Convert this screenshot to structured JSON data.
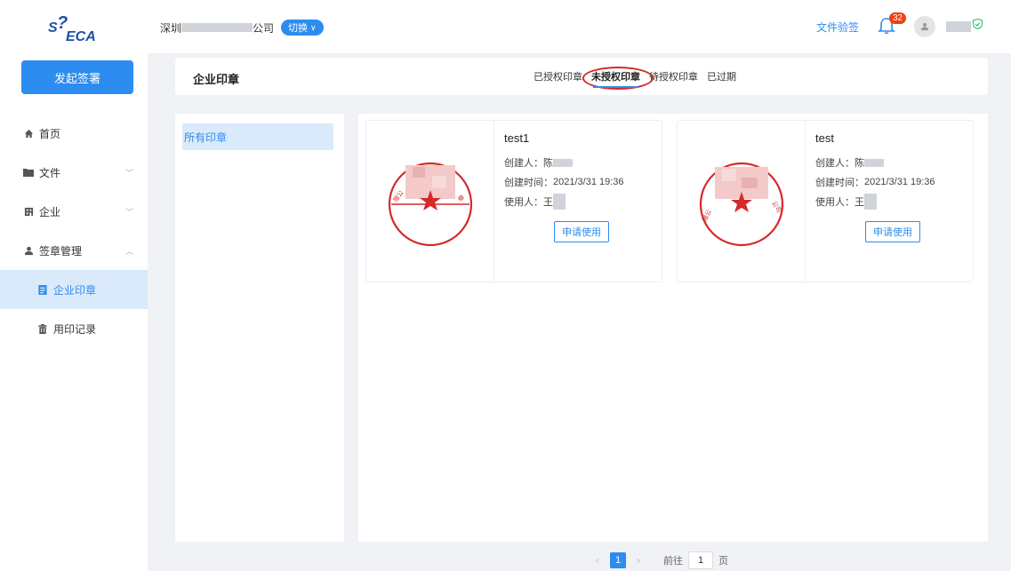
{
  "sidebar": {
    "logo_alt": "SHECA",
    "start_button": "发起签署",
    "items": [
      {
        "label": "首页",
        "icon": "home-icon"
      },
      {
        "label": "文件",
        "icon": "folder-icon"
      },
      {
        "label": "企业",
        "icon": "building-icon"
      },
      {
        "label": "签章管理",
        "icon": "user-icon"
      },
      {
        "label": "企业印章",
        "icon": "document-icon"
      },
      {
        "label": "用印记录",
        "icon": "trash-icon"
      }
    ]
  },
  "topbar": {
    "company_prefix": "深圳",
    "company_suffix": "公司",
    "switch_label": "切换",
    "doc_check": "文件验签",
    "notification_count": "32"
  },
  "header": {
    "title": "企业印章",
    "tabs": [
      "已授权印章",
      "未授权印章",
      "待授权印章",
      "已过期"
    ],
    "active_tab": "未授权印章"
  },
  "category": {
    "active": "所有印章"
  },
  "seals": [
    {
      "name": "test1",
      "creator_label": "创建人：",
      "creator_visible": "陈",
      "created_label": "创建时间：",
      "created_time": "2021/3/31 19:36",
      "user_label": "使用人：",
      "user_visible": "王",
      "apply_button": "申请使用"
    },
    {
      "name": "test",
      "creator_label": "创建人：",
      "creator_visible": "陈",
      "created_label": "创建时间：",
      "created_time": "2021/3/31 19:36",
      "user_label": "使用人：",
      "user_visible": "王",
      "apply_button": "申请使用"
    }
  ],
  "pagination": {
    "current": "1",
    "goto_label": "前往",
    "goto_value": "1",
    "page_unit": "页"
  },
  "colors": {
    "accent": "#2d8cf0",
    "seal_red": "#d42a2a",
    "badge_red": "#ed4014",
    "active_bg": "#dbeafb"
  }
}
